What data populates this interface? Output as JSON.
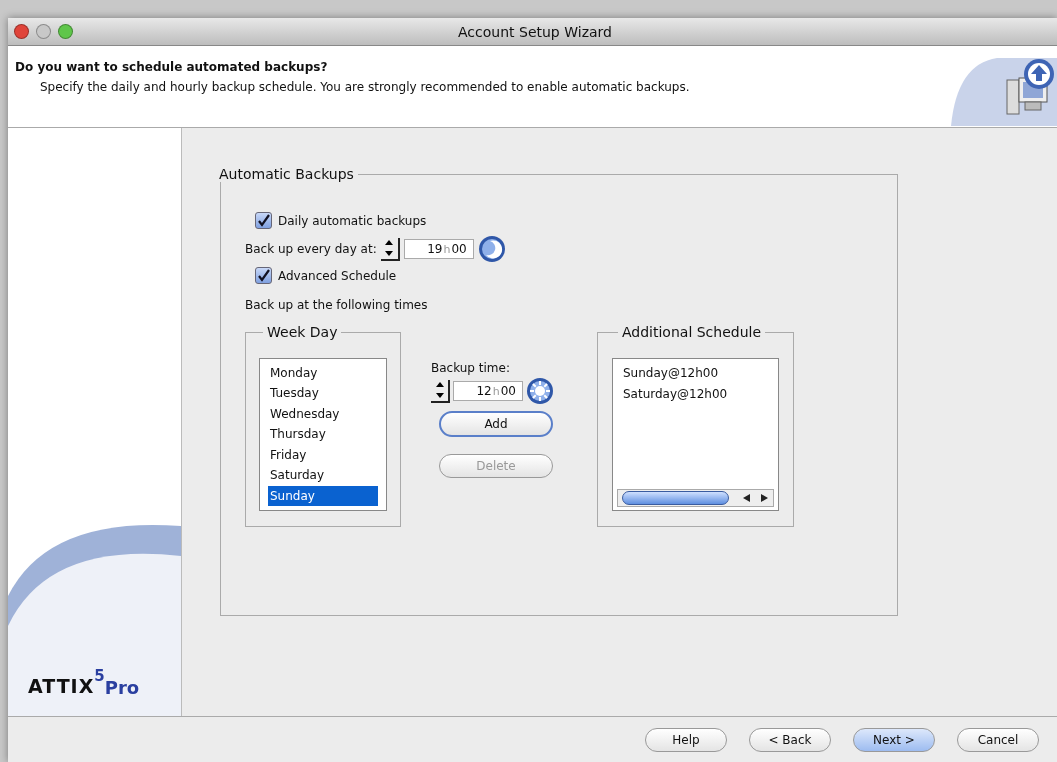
{
  "window": {
    "title": "Account Setup Wizard"
  },
  "header": {
    "title": "Do you want to schedule automated backups?",
    "subtitle": "Specify the daily and hourly backup schedule. You are strongly recommended to enable automatic backups."
  },
  "logo": {
    "name": "ATTIX",
    "version": "5",
    "edition": "Pro"
  },
  "group": {
    "title": "Automatic Backups",
    "daily": {
      "label": "Daily automatic backups",
      "checked": true
    },
    "daily_time": {
      "label": "Back up every day at:",
      "hours": "19",
      "separator": "h",
      "minutes": "00",
      "kind": "night"
    },
    "advanced": {
      "label": "Advanced Schedule",
      "checked": true
    },
    "following_label": "Back up at the following times",
    "week_day": {
      "title": "Week Day",
      "items": [
        {
          "label": "Monday",
          "selected": false
        },
        {
          "label": "Tuesday",
          "selected": false
        },
        {
          "label": "Wednesday",
          "selected": false
        },
        {
          "label": "Thursday",
          "selected": false
        },
        {
          "label": "Friday",
          "selected": false
        },
        {
          "label": "Saturday",
          "selected": false
        },
        {
          "label": "Sunday",
          "selected": true
        }
      ]
    },
    "backup_time": {
      "label": "Backup time:",
      "hours": "12",
      "separator": "h",
      "minutes": "00",
      "kind": "day"
    },
    "actions": [
      {
        "label": "Add",
        "disabled": false,
        "default": true
      },
      {
        "label": "Delete",
        "disabled": true,
        "default": false
      }
    ],
    "additional": {
      "title": "Additional Schedule",
      "items": [
        "Sunday@12h00",
        "Saturday@12h00"
      ]
    }
  },
  "buttons": [
    {
      "label": "Help",
      "default": false
    },
    {
      "label": "< Back",
      "default": false
    },
    {
      "label": "Next >",
      "default": true
    },
    {
      "label": "Cancel",
      "default": false
    }
  ]
}
